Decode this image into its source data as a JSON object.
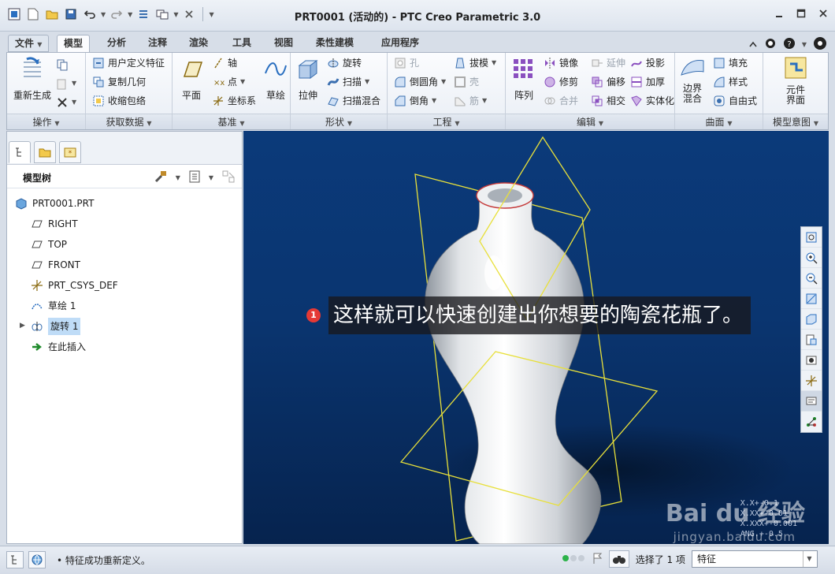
{
  "window": {
    "title": "PRT0001 (活动的) - PTC Creo Parametric 3.0"
  },
  "tabs": [
    {
      "label": "文件",
      "has_dropdown": true
    },
    {
      "label": "模型",
      "active": true
    },
    {
      "label": "分析"
    },
    {
      "label": "注释"
    },
    {
      "label": "渲染"
    },
    {
      "label": "工具"
    },
    {
      "label": "视图"
    },
    {
      "label": "柔性建模"
    },
    {
      "label": "应用程序"
    }
  ],
  "ribbon": {
    "groups": {
      "operations": "操作",
      "get_data": "获取数据",
      "datum": "基准",
      "shapes": "形状",
      "engineering": "工程",
      "editing": "编辑",
      "surfaces": "曲面",
      "model_intent": "模型意图"
    },
    "buttons": {
      "regenerate": "重新生成",
      "user_defined_feature": "用户定义特征",
      "copy_geometry": "复制几何",
      "shrinkwrap": "收缩包络",
      "plane": "平面",
      "axis": "轴",
      "point": "点",
      "csys": "坐标系",
      "sketch": "草绘",
      "extrude": "拉伸",
      "revolve": "旋转",
      "sweep": "扫描",
      "swept_blend": "扫描混合",
      "hole": "孔",
      "round": "倒圆角",
      "chamfer": "倒角",
      "draft": "拔模",
      "shell": "壳",
      "rib": "筋",
      "pattern": "阵列",
      "mirror": "镜像",
      "trim": "修剪",
      "merge": "合并",
      "extend": "延伸",
      "offset": "偏移",
      "intersect": "相交",
      "project": "投影",
      "thicken": "加厚",
      "solidify": "实体化",
      "boundary_blend": "边界\n混合",
      "fill": "填充",
      "style": "样式",
      "freestyle": "自由式",
      "component_interface": "元件\n界面"
    }
  },
  "model_tree": {
    "header": "模型树",
    "items": [
      {
        "label": "PRT0001.PRT",
        "icon": "part-icon"
      },
      {
        "label": "RIGHT",
        "icon": "datum-plane-icon"
      },
      {
        "label": "TOP",
        "icon": "datum-plane-icon"
      },
      {
        "label": "FRONT",
        "icon": "datum-plane-icon"
      },
      {
        "label": "PRT_CSYS_DEF",
        "icon": "csys-icon"
      },
      {
        "label": "草绘 1",
        "icon": "sketch-icon"
      },
      {
        "label": "旋转 1",
        "icon": "revolve-icon",
        "selected": true
      },
      {
        "label": "在此插入",
        "icon": "insert-arrow-icon"
      }
    ]
  },
  "viewport": {
    "annotation_number": "1",
    "annotation_text": "这样就可以快速创建出你想要的陶瓷花瓶了。",
    "coord_lines": [
      "X.X+-0.1",
      "X.XX+-0.01",
      "X.XXX+-0.001",
      "ANG.+-0.5"
    ],
    "watermark": "Bai du 经验",
    "watermark_url": "jingyan.baidu.com"
  },
  "status": {
    "message": "特征成功重新定义。",
    "selection": "选择了 1 项",
    "filter": "特征"
  },
  "colors": {
    "viewport_top": "#0b3a7a",
    "selected_item": "#bfdcf7",
    "datum_plane": "#f0e53a",
    "annotation_badge": "#e53935"
  }
}
